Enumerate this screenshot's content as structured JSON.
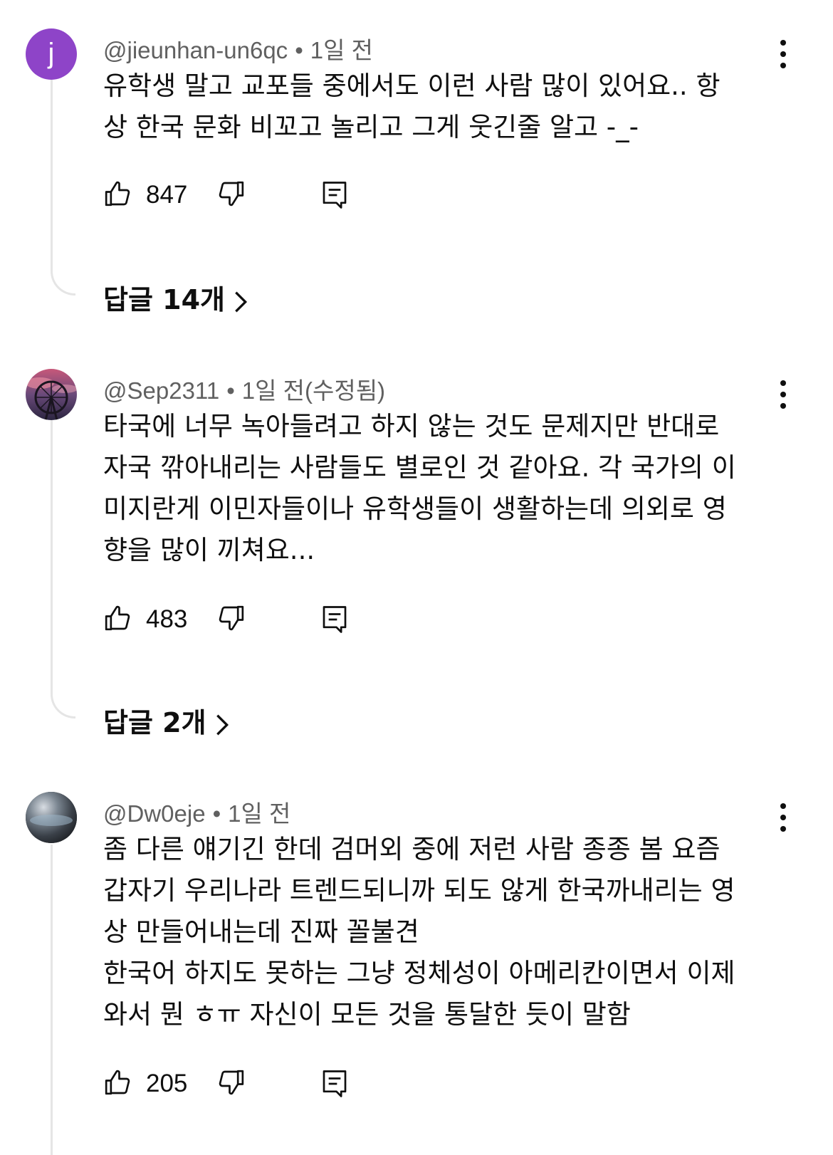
{
  "comments": [
    {
      "handle": "@jieunhan-un6qc",
      "avatar_letter": "j",
      "time": "1일 전",
      "text": "유학생 말고 교포들 중에서도 이런 사람 많이 있어요.. 항\n상 한국 문화 비꼬고 놀리고 그게 웃긴줄 알고 -_-",
      "likes": "847",
      "replies": "답글 14개"
    },
    {
      "handle": "@Sep2311",
      "time": "1일 전(수정됨)",
      "text": "타국에 너무 녹아들려고 하지 않는 것도 문제지만 반대로\n자국 깎아내리는 사람들도 별로인 것 같아요. 각 국가의 이\n미지란게 이민자들이나 유학생들이 생활하는데 의외로 영\n향을 많이 끼쳐요...",
      "likes": "483",
      "replies": "답글 2개"
    },
    {
      "handle": "@Dw0eje",
      "time": "1일 전",
      "text": "좀 다른 얘기긴 한데 검머외 중에 저런 사람 종종 봄 요즘\n갑자기 우리나라 트렌드되니까 되도 않게 한국까내리는 영\n상 만들어내는데 진짜 꼴불견\n한국어 하지도 못하는 그냥 정체성이 아메리칸이면서 이제\n와서 뭔 ㅎㅠ 자신이 모든 것을 통달한 듯이 말함",
      "likes": "205"
    }
  ],
  "colors": {
    "avatar_letter_bg": "#8e44c8",
    "meta": "#606060",
    "thread": "#e5e5e5"
  },
  "icons": [
    "like-icon",
    "dislike-icon",
    "reply-icon",
    "more-options-icon",
    "chevron-right-icon"
  ]
}
